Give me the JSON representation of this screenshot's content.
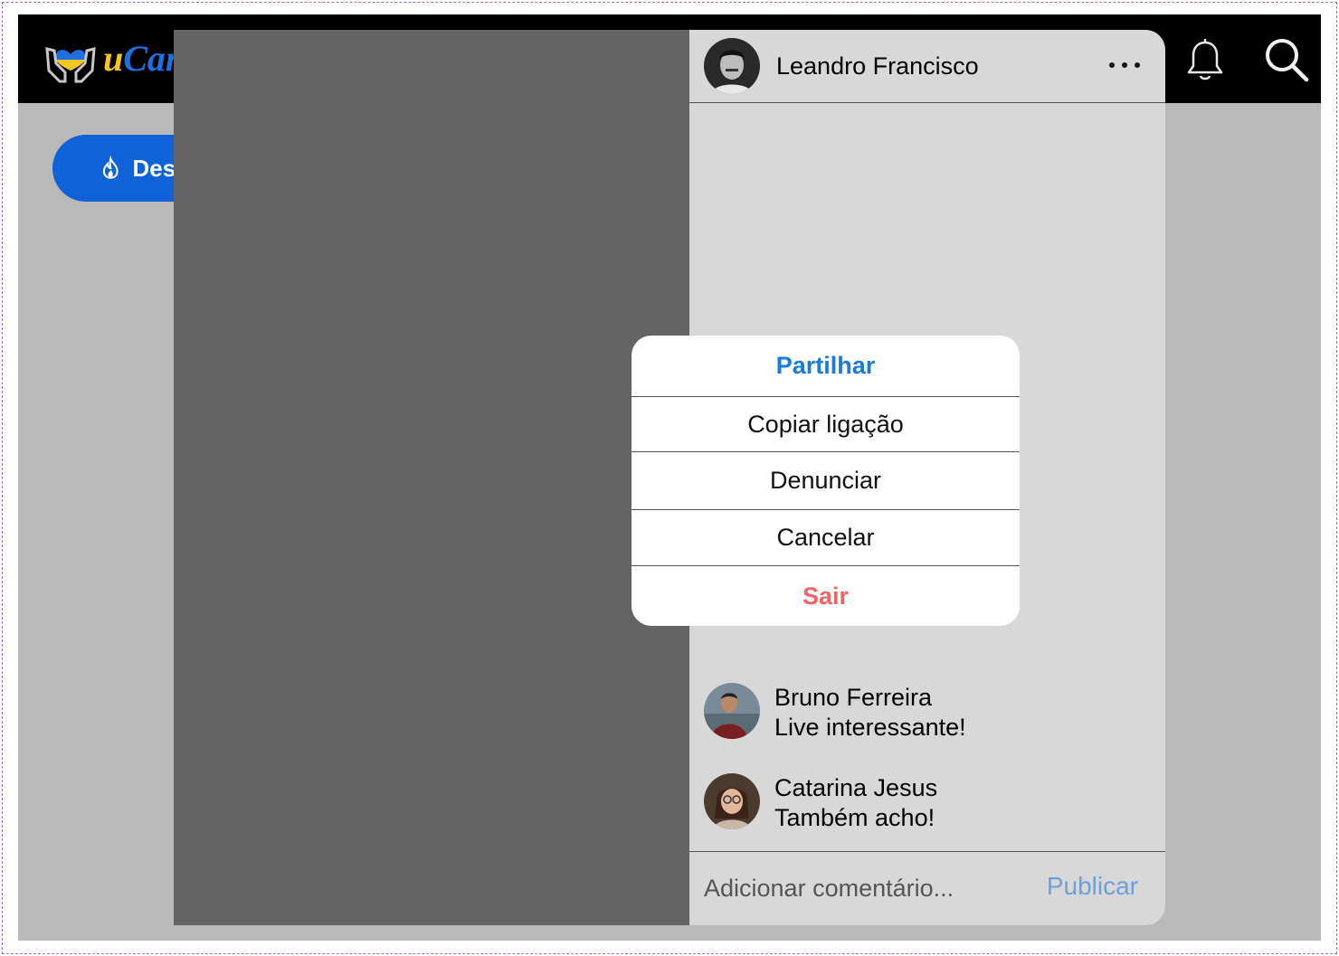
{
  "app": {
    "logo_text_u": "u",
    "logo_text_rest": "Can",
    "pill_label": "Destaques",
    "icons": [
      "hands-heart-icon",
      "bell-icon",
      "search-icon",
      "flame-icon",
      "more-icon"
    ],
    "colors": {
      "brand_blue": "#0f62d8",
      "brand_yellow": "#f3c623",
      "danger": "#ef6464",
      "link": "#1a7ae0"
    }
  },
  "post": {
    "author": "Leandro Francisco",
    "comments": [
      {
        "name": "Bruno Ferreira",
        "text": "Live interessante!"
      },
      {
        "name": "Catarina Jesus",
        "text": "Também acho!"
      }
    ],
    "composer": {
      "placeholder": "Adicionar comentário...",
      "publish_label": "Publicar"
    }
  },
  "action_sheet": {
    "share": "Partilhar",
    "copy_link": "Copiar ligação",
    "report": "Denunciar",
    "cancel": "Cancelar",
    "leave": "Sair"
  }
}
